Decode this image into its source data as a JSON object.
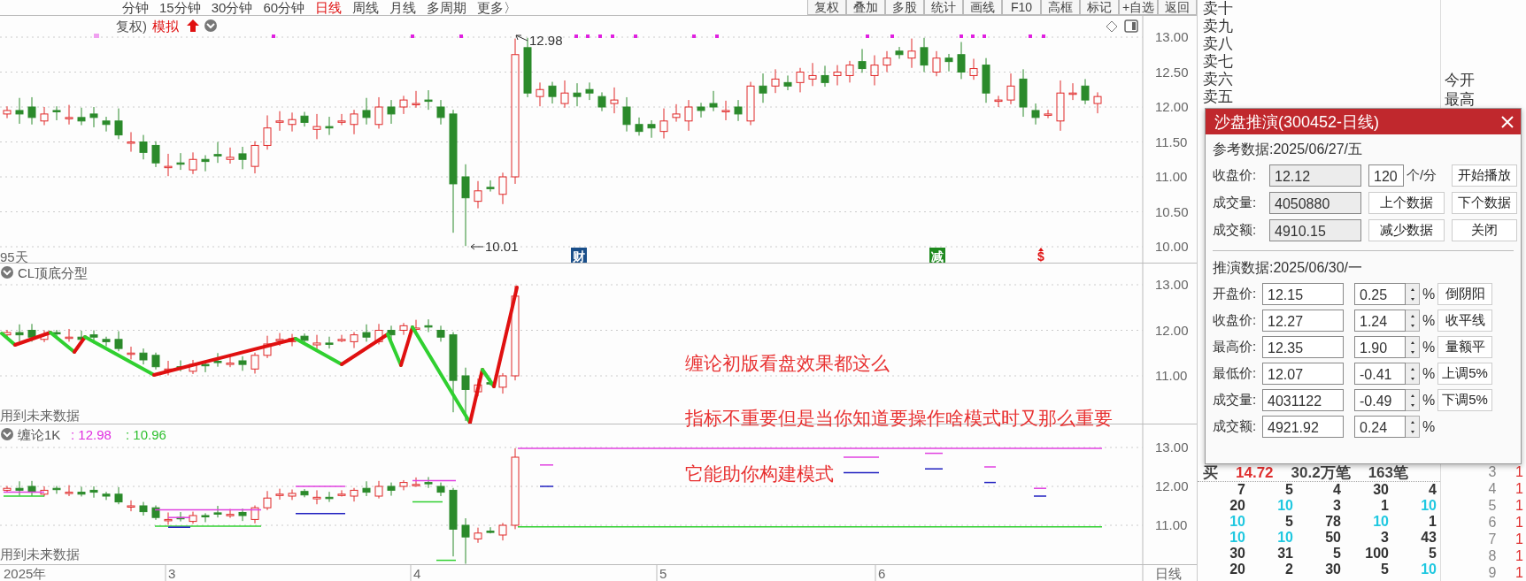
{
  "period_tabs": [
    {
      "label": "分钟",
      "selected": false
    },
    {
      "label": "15分钟",
      "selected": false
    },
    {
      "label": "30分钟",
      "selected": false
    },
    {
      "label": "60分钟",
      "selected": false
    },
    {
      "label": "日线",
      "selected": true
    },
    {
      "label": "周线",
      "selected": false
    },
    {
      "label": "月线",
      "selected": false
    },
    {
      "label": "多周期",
      "selected": false
    },
    {
      "label": "更多〉",
      "selected": false
    }
  ],
  "toolbar_buttons": [
    "复权",
    "叠加",
    "多股",
    "统计",
    "画线",
    "F10",
    "高框",
    "标记",
    "+自选",
    "返回"
  ],
  "main_chart": {
    "header_label": "复权)",
    "mode": "模拟",
    "price_axis": [
      "13.00",
      "12.50",
      "12.00",
      "11.50",
      "11.00",
      "10.50",
      "10.00"
    ],
    "high_marker": "12.98",
    "low_marker": "10.01",
    "days_label": "95天",
    "markers": [
      {
        "kind": "finance",
        "text": "财"
      },
      {
        "kind": "reduce",
        "text": "减"
      },
      {
        "kind": "signal",
        "text": "$"
      }
    ]
  },
  "indicator_1": {
    "title": "CL顶底分型",
    "note": "用到未来数据",
    "price_axis": [
      "13.00",
      "12.00",
      "11.00"
    ]
  },
  "indicator_2": {
    "title": "缠论1K",
    "values": [
      {
        "text": ": 12.98",
        "color": "#e030e0"
      },
      {
        "text": ": 10.96",
        "color": "#30c030"
      }
    ],
    "note": "用到未来数据",
    "price_axis": [
      "13.00",
      "12.00",
      "11.00"
    ]
  },
  "annotations": [
    "缠论初版看盘效果都这么",
    "指标不重要但是当你知道要操作啥模式时又那么重要",
    "它能助你构建模式"
  ],
  "time_axis": {
    "labels": [
      "2025年",
      "3",
      "4",
      "5",
      "6"
    ],
    "period": "日线"
  },
  "order_book": {
    "sell_levels": [
      "卖十",
      "卖九",
      "卖八",
      "卖七",
      "卖六",
      "卖五"
    ],
    "buy_summary": [
      "买",
      "14.72",
      "30.2万笔",
      "163笔"
    ],
    "trade_rows": [
      [
        {
          "text": "7",
          "highlight": false
        },
        {
          "text": "5",
          "highlight": false
        },
        {
          "text": "4",
          "highlight": false
        },
        {
          "text": "30",
          "highlight": false
        },
        {
          "text": "4",
          "highlight": false
        }
      ],
      [
        {
          "text": "20",
          "highlight": false
        },
        {
          "text": "10",
          "highlight": true
        },
        {
          "text": "3",
          "highlight": false
        },
        {
          "text": "1",
          "highlight": false
        },
        {
          "text": "10",
          "highlight": true
        }
      ],
      [
        {
          "text": "10",
          "highlight": true
        },
        {
          "text": "5",
          "highlight": false
        },
        {
          "text": "78",
          "highlight": false
        },
        {
          "text": "10",
          "highlight": true
        },
        {
          "text": "1",
          "highlight": false
        }
      ],
      [
        {
          "text": "10",
          "highlight": true
        },
        {
          "text": "10",
          "highlight": true
        },
        {
          "text": "50",
          "highlight": false
        },
        {
          "text": "3",
          "highlight": false
        },
        {
          "text": "43",
          "highlight": false
        }
      ],
      [
        {
          "text": "30",
          "highlight": false
        },
        {
          "text": "31",
          "highlight": false
        },
        {
          "text": "5",
          "highlight": false
        },
        {
          "text": "100",
          "highlight": false
        },
        {
          "text": "5",
          "highlight": false
        }
      ],
      [
        {
          "text": "20",
          "highlight": false
        },
        {
          "text": "2",
          "highlight": false
        },
        {
          "text": "30",
          "highlight": false
        },
        {
          "text": "5",
          "highlight": false
        },
        {
          "text": "10",
          "highlight": true
        }
      ]
    ]
  },
  "quote_panel": {
    "labels": [
      "今开",
      "最高"
    ],
    "rows": [
      {
        "index": "3",
        "price": "1"
      },
      {
        "index": "4",
        "price": "1"
      },
      {
        "index": "5",
        "price": "1"
      },
      {
        "index": "6",
        "price": "1"
      },
      {
        "index": "7",
        "price": "1"
      },
      {
        "index": "8",
        "price": "1"
      },
      {
        "index": "9",
        "price": "1"
      }
    ]
  },
  "dialog": {
    "title": "沙盘推演(300452-日线)",
    "reference": {
      "heading": "参考数据:2025/06/27/五",
      "rows": [
        {
          "label": "收盘价:",
          "value": "12.12",
          "readonly": true
        },
        {
          "label": "成交量:",
          "value": "4050880",
          "readonly": true
        },
        {
          "label": "成交额:",
          "value": "4910.15",
          "readonly": true
        }
      ],
      "speed": "120",
      "speed_unit": "个/分",
      "buttons": [
        "开始播放",
        "上个数据",
        "下个数据",
        "减少数据",
        "关闭"
      ]
    },
    "projection": {
      "heading": "推演数据:2025/06/30/一",
      "rows": [
        {
          "label": "开盘价:",
          "value": "12.15",
          "percent": "0.25",
          "unit": "%",
          "button": "倒阴阳"
        },
        {
          "label": "收盘价:",
          "value": "12.27",
          "percent": "1.24",
          "unit": "%",
          "button": "收平线"
        },
        {
          "label": "最高价:",
          "value": "12.35",
          "percent": "1.90",
          "unit": "%",
          "button": "量额平"
        },
        {
          "label": "最低价:",
          "value": "12.07",
          "percent": "-0.41",
          "unit": "%",
          "button": "上调5%"
        },
        {
          "label": "成交量:",
          "value": "4031122",
          "percent": "-0.49",
          "unit": "%",
          "button": "下调5%"
        },
        {
          "label": "成交额:",
          "value": "4921.92",
          "percent": "0.24",
          "unit": "%"
        }
      ]
    }
  }
}
